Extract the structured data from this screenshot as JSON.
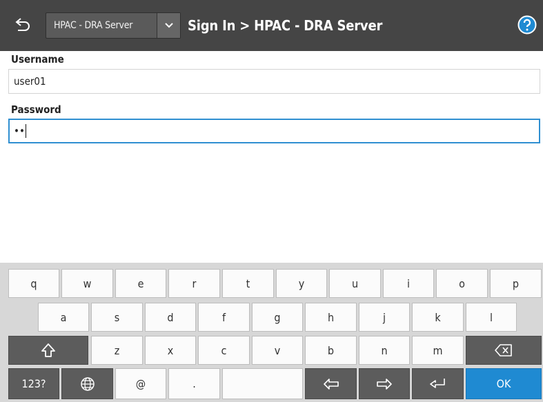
{
  "header": {
    "server_select_value": "HPAC - DRA Server",
    "title": "Sign In > HPAC - DRA Server",
    "back_icon": "back-icon",
    "help_icon": "help-icon"
  },
  "form": {
    "username_label": "Username",
    "username_value": "user01",
    "password_label": "Password",
    "password_value": "••"
  },
  "keyboard": {
    "row1": [
      "q",
      "w",
      "e",
      "r",
      "t",
      "y",
      "u",
      "i",
      "o",
      "p"
    ],
    "row2": [
      "a",
      "s",
      "d",
      "f",
      "g",
      "h",
      "j",
      "k",
      "l"
    ],
    "row3": [
      "z",
      "x",
      "c",
      "v",
      "b",
      "n",
      "m"
    ],
    "mode_key": "123?",
    "at_key": "@",
    "period_key": ".",
    "ok_key": "OK",
    "icons": [
      "shift-icon",
      "backspace-icon",
      "globe-icon",
      "left-arrow-icon",
      "right-arrow-icon",
      "enter-icon"
    ]
  },
  "colors": {
    "header_bg": "#454545",
    "accent": "#1f8ad2",
    "dark_key": "#5c5c5c"
  }
}
